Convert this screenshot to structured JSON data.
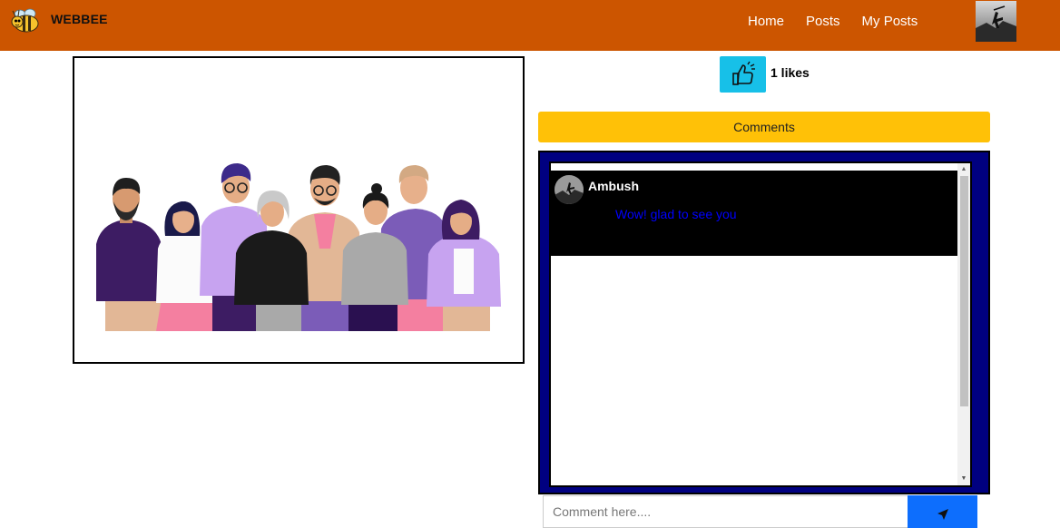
{
  "navbar": {
    "brand": "WEBBEE",
    "brand_icon": "bee-icon",
    "links": [
      "Home",
      "Posts",
      "My Posts"
    ],
    "avatar_icon": "user-avatar"
  },
  "post": {
    "image_icon": "group-of-people-illustration",
    "likes_icon": "thumbs-up-icon",
    "likes_text": "1 likes",
    "comments_label": "Comments"
  },
  "comments": [
    {
      "author": "Ambush",
      "text": "Wow! glad to see you"
    }
  ],
  "comment_form": {
    "placeholder": "Comment here....",
    "send_icon": "send-icon"
  },
  "colors": {
    "navbar": "#cc5500",
    "like_button": "#17c0e8",
    "comments_header": "#ffc107",
    "comments_border": "#000080",
    "comment_card": "#000000",
    "comment_text": "#0000ff",
    "send_button": "#0d6efd"
  }
}
